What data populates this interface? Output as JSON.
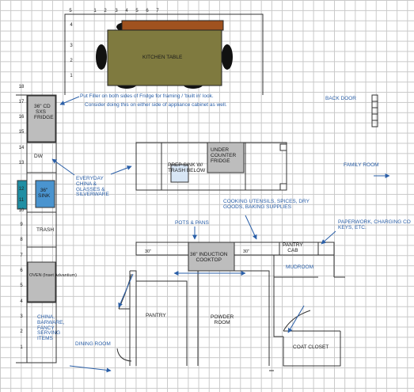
{
  "top_ruler": [
    "5",
    "1",
    "2",
    "3",
    "4",
    "5",
    "6",
    "7"
  ],
  "left_ruler_top": [
    "4",
    "3",
    "2",
    "1"
  ],
  "left_ruler_wall": [
    "18",
    "17",
    "16",
    "15",
    "14",
    "13",
    "12",
    "11",
    "10",
    "9",
    "8",
    "7",
    "6",
    "5",
    "4",
    "3",
    "2",
    "1"
  ],
  "labels": {
    "kitchen_table": "KITCHEN TABLE",
    "filler_note_1": "Put Filler on both sides of Fridge for framing / 'built in' look.",
    "filler_note_2": "Consider doing this on either side of appliance cabinet as well.",
    "fridge": [
      "36\" CD",
      "SXS",
      "FRIDGE"
    ],
    "back_door": "BACK DOOR",
    "dw": "DW",
    "sink": [
      "36\"",
      "SINK"
    ],
    "everyday": [
      "EVERYDAY",
      "CHINA &",
      "GLASSES &",
      "SILVERWARE"
    ],
    "prep_sink": [
      "PREP SINK W/",
      "TRASH BELOW"
    ],
    "under_fridge": [
      "UNDER",
      "COUNTER",
      "FRIDGE"
    ],
    "family_room": "FAMILY ROOM",
    "cooking_utensils": [
      "COOKING UTENSILS, SPICES, DRY",
      "GOODS, BAKING SUPPLIES"
    ],
    "pots_pans": "POTS & PANS",
    "paperwork": [
      "PAPERWORK, CHARGING CO",
      "KEYS, ETC."
    ],
    "trash": "TRASH",
    "width_30_left": "30\"",
    "width_30_right": "30\"",
    "cooktop": [
      "36\" INDUCTION",
      "COOKTOP"
    ],
    "pantry_cab": [
      "PANTRY",
      "CAB"
    ],
    "mudroom": "MUDROOM",
    "oven": "OVEN (Inset Advantium)",
    "china": [
      "CHINA,",
      "BARWARE,",
      "FANCY",
      "SERVING",
      "ITEMS"
    ],
    "pantry": "PANTRY",
    "powder_room": [
      "POWDER",
      "ROOM"
    ],
    "dining_room": "DINING ROOM",
    "coat_closet": "COAT CLOSET"
  },
  "colors": {
    "table_top": "#7f7a3f",
    "table_edge": "#a0521f",
    "chair": "#111111",
    "appliance_gray": "#bdbdbd",
    "sink_blue": "#4a94cf",
    "sink_teal": "#1f8fa4",
    "wall": "#333333",
    "annotation_blue": "#2a5fa8"
  }
}
